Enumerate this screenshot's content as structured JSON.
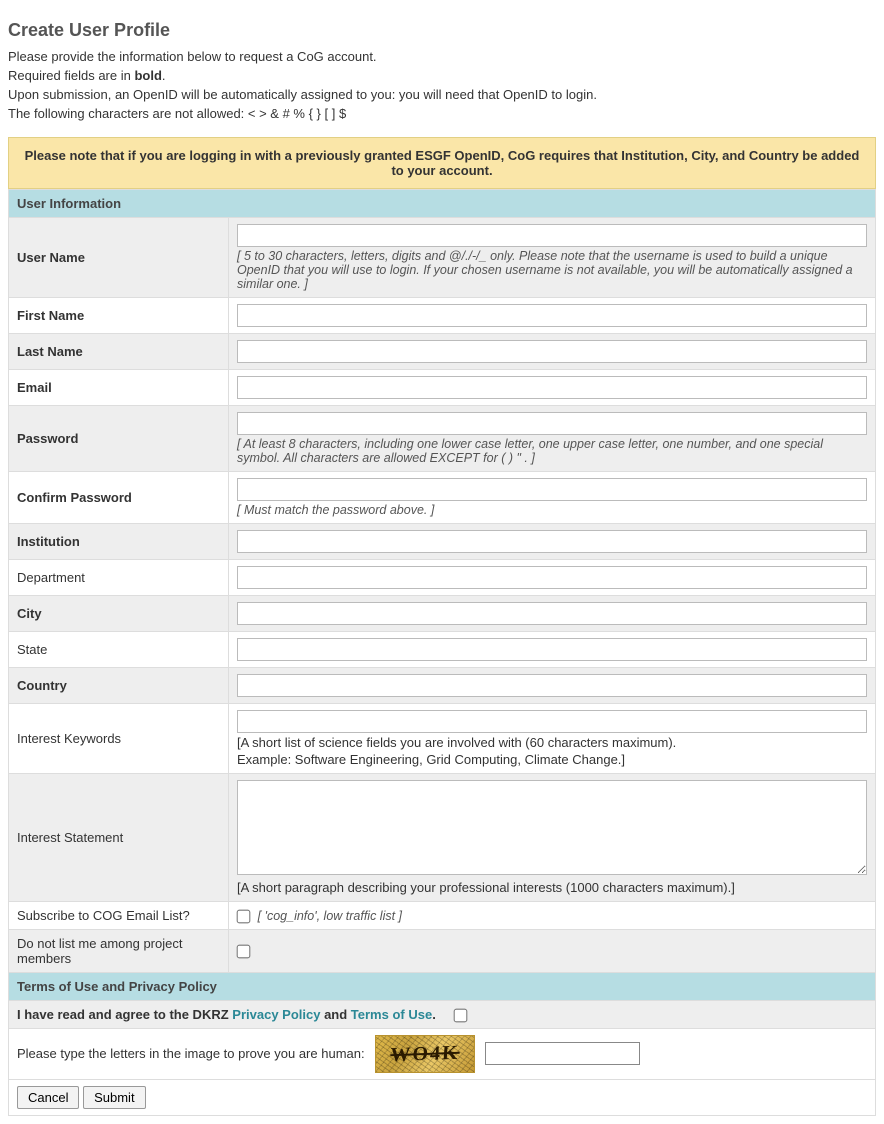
{
  "page": {
    "title": "Create User Profile",
    "intro_line1": "Please provide the information below to request a CoG account.",
    "intro_line2_prefix": "Required fields are in ",
    "intro_line2_bold": "bold",
    "intro_line2_suffix": ".",
    "intro_line3": "Upon submission, an OpenID will be automatically assigned to you: you will need that OpenID to login.",
    "intro_line4": "The following characters are not allowed: < > & # % { } [ ] $"
  },
  "notice": "Please note that if you are logging in with a previously granted ESGF OpenID, CoG requires that Institution, City, and Country be added to your account.",
  "sections": {
    "user_info": "User Information",
    "terms": "Terms of Use and Privacy Policy"
  },
  "fields": {
    "username": {
      "label": "User Name",
      "hint": "[ 5 to 30 characters, letters, digits and @/./-/_ only. Please note that the username is used to build a unique OpenID that you will use to login. If your chosen username is not available, you will be automatically assigned a similar one. ]"
    },
    "first_name": {
      "label": "First Name"
    },
    "last_name": {
      "label": "Last Name"
    },
    "email": {
      "label": "Email"
    },
    "password": {
      "label": "Password",
      "hint": "[ At least 8 characters, including one lower case letter, one upper case letter, one number, and one special symbol. All characters are allowed EXCEPT for ( ) \" . ]"
    },
    "confirm_password": {
      "label": "Confirm Password",
      "hint": "[ Must match the password above. ]"
    },
    "institution": {
      "label": "Institution"
    },
    "department": {
      "label": "Department"
    },
    "city": {
      "label": "City"
    },
    "state": {
      "label": "State"
    },
    "country": {
      "label": "Country"
    },
    "interest_keywords": {
      "label": "Interest Keywords",
      "hint_line1": "[A short list of science fields you are involved with (60 characters maximum).",
      "hint_line2": "Example: Software Engineering, Grid Computing, Climate Change.]"
    },
    "interest_statement": {
      "label": "Interest Statement",
      "hint": "[A short paragraph describing your professional interests (1000 characters maximum).]"
    },
    "subscribe": {
      "label": "Subscribe to COG Email List?",
      "hint": "[ 'cog_info', low traffic list ]"
    },
    "do_not_list": {
      "label": "Do not list me among project members"
    }
  },
  "terms": {
    "prefix": "I have read and agree to the DKRZ ",
    "privacy_label": "Privacy Policy",
    "and": " and ",
    "tou_label": "Terms of Use",
    "suffix": "."
  },
  "captcha": {
    "prompt": "Please type the letters in the image to prove you are human:",
    "image_text": "WO4K"
  },
  "buttons": {
    "cancel": "Cancel",
    "submit": "Submit"
  }
}
